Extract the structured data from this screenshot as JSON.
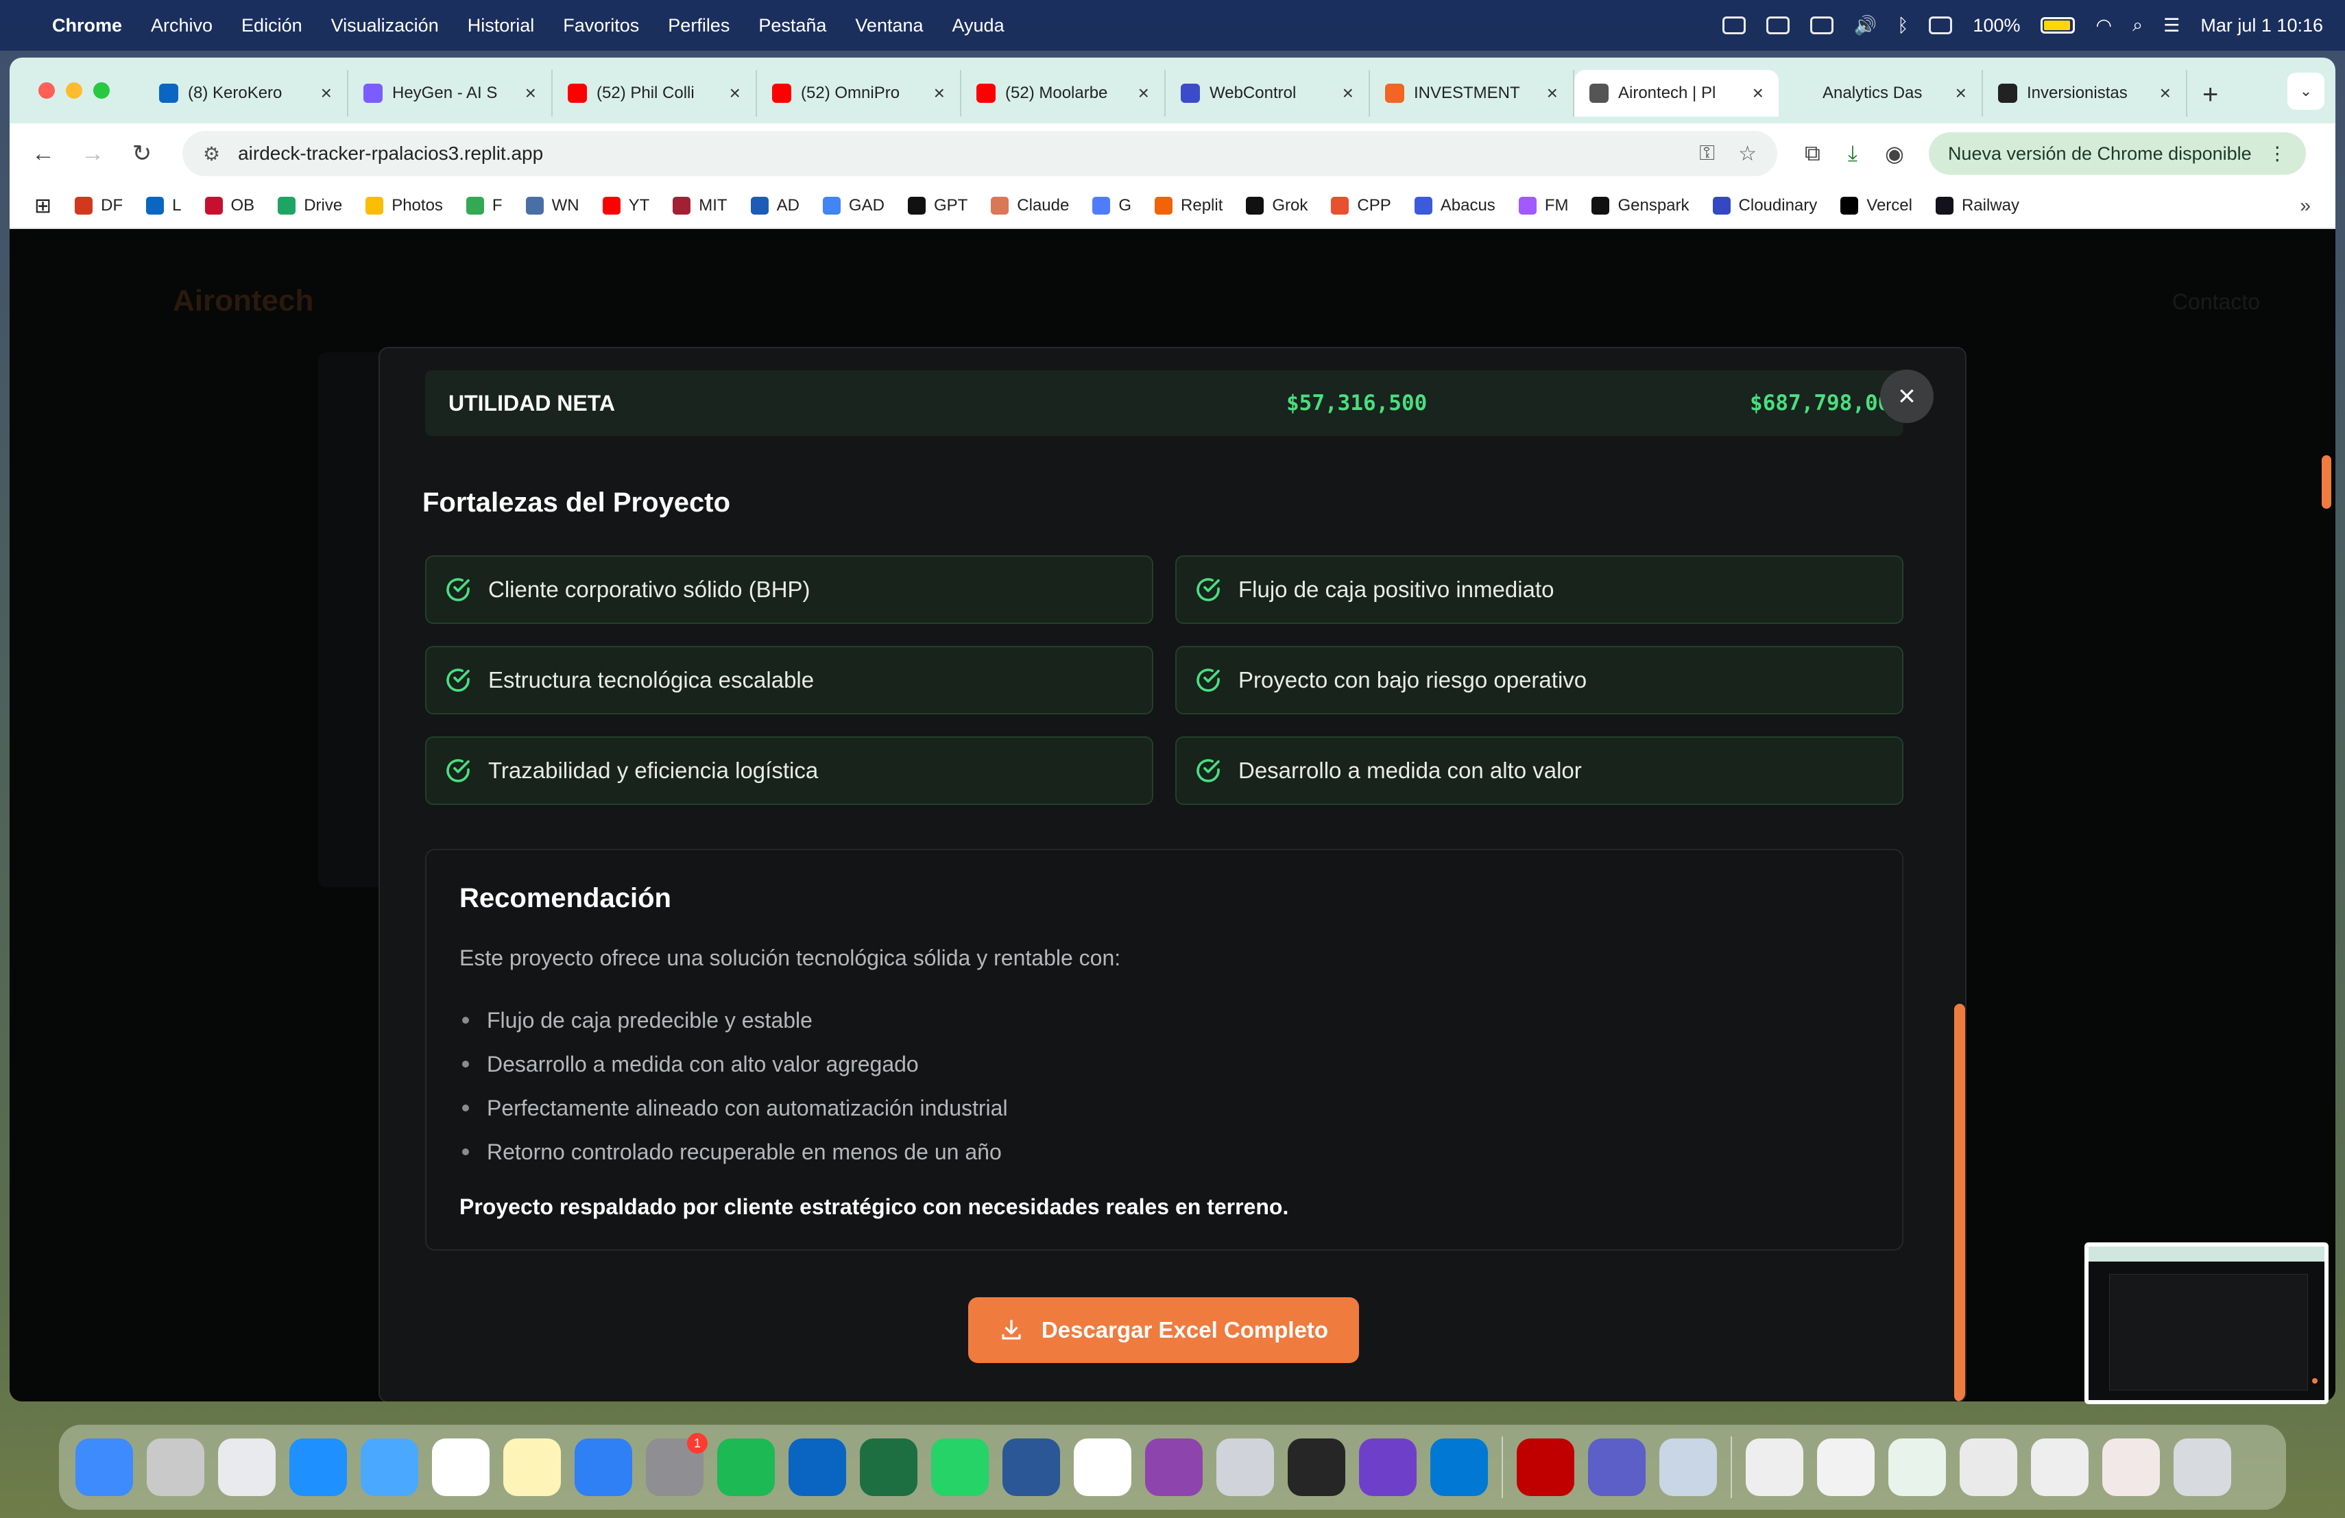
{
  "menubar": {
    "app_name": "Chrome",
    "menus": [
      "Archivo",
      "Edición",
      "Visualización",
      "Historial",
      "Favoritos",
      "Perfiles",
      "Pestaña",
      "Ventana",
      "Ayuda"
    ],
    "battery": "100%",
    "datetime": "Mar jul 1  10:16"
  },
  "tabs": [
    {
      "title": "(8) KeroKero",
      "color": "#0a66c2"
    },
    {
      "title": "HeyGen - AI S",
      "color": "#7b5cff"
    },
    {
      "title": "(52) Phil Colli",
      "color": "#ff0000"
    },
    {
      "title": "(52) OmniPro",
      "color": "#ff0000"
    },
    {
      "title": "(52) Moolarbe",
      "color": "#ff0000"
    },
    {
      "title": "WebControl",
      "color": "#3b4cca"
    },
    {
      "title": "INVESTMENT",
      "color": "#f26522"
    },
    {
      "title": "Airontech | Pl",
      "color": "#555555"
    },
    {
      "title": "Analytics Das",
      "color": "#d9f0ea"
    },
    {
      "title": "Inversionistas",
      "color": "#222222"
    }
  ],
  "active_tab_index": 7,
  "toolbar": {
    "url": "airdeck-tracker-rpalacios3.replit.app",
    "update_label": "Nueva versión de Chrome disponible"
  },
  "bookmarks": [
    {
      "label": "DF",
      "color": "#d2381e"
    },
    {
      "label": "L",
      "color": "#0a66c2"
    },
    {
      "label": "OB",
      "color": "#c8102e"
    },
    {
      "label": "Drive",
      "color": "#1fa463"
    },
    {
      "label": "Photos",
      "color": "#fbbc04"
    },
    {
      "label": "F",
      "color": "#34a853"
    },
    {
      "label": "WN",
      "color": "#4a6fa5"
    },
    {
      "label": "YT",
      "color": "#ff0000"
    },
    {
      "label": "MIT",
      "color": "#a31f34"
    },
    {
      "label": "AD",
      "color": "#1e5bb8"
    },
    {
      "label": "GAD",
      "color": "#4285f4"
    },
    {
      "label": "GPT",
      "color": "#111111"
    },
    {
      "label": "Claude",
      "color": "#d97757"
    },
    {
      "label": "G",
      "color": "#4f7cff"
    },
    {
      "label": "Replit",
      "color": "#f26207"
    },
    {
      "label": "Grok",
      "color": "#111111"
    },
    {
      "label": "CPP",
      "color": "#e8502f"
    },
    {
      "label": "Abacus",
      "color": "#3b5bdb"
    },
    {
      "label": "FM",
      "color": "#a259ff"
    },
    {
      "label": "Genspark",
      "color": "#111111"
    },
    {
      "label": "Cloudinary",
      "color": "#3448c5"
    },
    {
      "label": "Vercel",
      "color": "#000000"
    },
    {
      "label": "Railway",
      "color": "#13111c"
    }
  ],
  "page": {
    "bg_logo": "Airontech",
    "bg_nav": "Contacto"
  },
  "modal": {
    "net_label": "UTILIDAD NETA",
    "net_value_monthly": "$57,316,500",
    "net_value_annual": "$687,798,000",
    "strengths_title": "Fortalezas del Proyecto",
    "strengths": [
      "Cliente corporativo sólido (BHP)",
      "Flujo de caja positivo inmediato",
      "Estructura tecnológica escalable",
      "Proyecto con bajo riesgo operativo",
      "Trazabilidad y eficiencia logística",
      "Desarrollo a medida con alto valor"
    ],
    "reco_title": "Recomendación",
    "reco_intro": "Este proyecto ofrece una solución tecnológica sólida y rentable con:",
    "reco_items": [
      "Flujo de caja predecible y estable",
      "Desarrollo a medida con alto valor agregado",
      "Perfectamente alineado con automatización industrial",
      "Retorno controlado recuperable en menos de un año"
    ],
    "reco_final": "Proyecto respaldado por cliente estratégico con necesidades reales en terreno.",
    "download_label": "Descargar Excel Completo"
  },
  "colors": {
    "accent": "#f07b3f",
    "positive": "#4ade80",
    "check": "#4ade80"
  },
  "dock": [
    {
      "name": "finder",
      "color": "#3d8bfd"
    },
    {
      "name": "launchpad",
      "color": "#c9c9c9"
    },
    {
      "name": "chrome",
      "color": "#e8eaed"
    },
    {
      "name": "safari",
      "color": "#1e90ff"
    },
    {
      "name": "mail",
      "color": "#4aa8ff"
    },
    {
      "name": "calendar",
      "color": "#ffffff"
    },
    {
      "name": "notes",
      "color": "#fff4b8"
    },
    {
      "name": "keynote",
      "color": "#2f7ff5"
    },
    {
      "name": "system-settings",
      "color": "#8e8e93"
    },
    {
      "name": "spotify",
      "color": "#1db954"
    },
    {
      "name": "outlook",
      "color": "#0a64c2"
    },
    {
      "name": "excel",
      "color": "#1d6f42"
    },
    {
      "name": "whatsapp",
      "color": "#25d366"
    },
    {
      "name": "word",
      "color": "#2b5797"
    },
    {
      "name": "fantastical",
      "color": "#ffffff"
    },
    {
      "name": "screen-recorder",
      "color": "#8e44ad"
    },
    {
      "name": "iphone-mirroring",
      "color": "#d0d4da"
    },
    {
      "name": "replit",
      "color": "#262626"
    },
    {
      "name": "github-desktop",
      "color": "#6e40c9"
    },
    {
      "name": "vscode",
      "color": "#0078d4"
    },
    {
      "name": "acrobat",
      "color": "#c00000"
    },
    {
      "name": "teams",
      "color": "#5b5fc7"
    },
    {
      "name": "preview",
      "color": "#c8d6e5"
    },
    {
      "name": "doc-1",
      "color": "#eeeeee"
    },
    {
      "name": "doc-2",
      "color": "#f2f2f2"
    },
    {
      "name": "doc-3",
      "color": "#e8f3ec"
    },
    {
      "name": "doc-4",
      "color": "#eaeaea"
    },
    {
      "name": "doc-5",
      "color": "#eeeeee"
    },
    {
      "name": "doc-6",
      "color": "#f3e8e8"
    },
    {
      "name": "trash",
      "color": "#d7dbe0"
    }
  ]
}
